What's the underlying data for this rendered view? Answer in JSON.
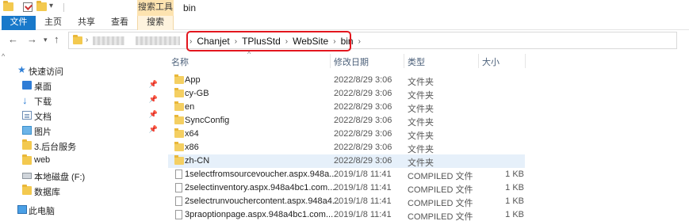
{
  "window": {
    "title": "bin",
    "context_tab_group": "搜索工具"
  },
  "ribbon": {
    "tabs": [
      "文件",
      "主页",
      "共享",
      "查看",
      "搜索"
    ]
  },
  "breadcrumb": [
    "Chanjet",
    "TPlusStd",
    "WebSite",
    "bin"
  ],
  "navpane": {
    "items": [
      {
        "label": "快速访问",
        "icon": "star-icon",
        "pinned": false
      },
      {
        "label": "桌面",
        "icon": "desktop-icon",
        "pinned": true
      },
      {
        "label": "下载",
        "icon": "download-icon",
        "pinned": true
      },
      {
        "label": "文档",
        "icon": "documents-icon",
        "pinned": true
      },
      {
        "label": "图片",
        "icon": "pictures-icon",
        "pinned": true
      },
      {
        "label": "3.后台服务",
        "icon": "folder-icon",
        "pinned": false
      },
      {
        "label": "web",
        "icon": "folder-icon",
        "pinned": false
      },
      {
        "label": "本地磁盘 (F:)",
        "icon": "drive-icon",
        "pinned": false
      },
      {
        "label": "数据库",
        "icon": "folder-icon",
        "pinned": false
      },
      {
        "label": "此电脑",
        "icon": "computer-icon",
        "pinned": false
      }
    ]
  },
  "columns": {
    "name": "名称",
    "date": "修改日期",
    "type": "类型",
    "size": "大小"
  },
  "files": [
    {
      "name": "App",
      "date": "2022/8/29 3:06",
      "type": "文件夹",
      "size": "",
      "kind": "folder"
    },
    {
      "name": "cy-GB",
      "date": "2022/8/29 3:06",
      "type": "文件夹",
      "size": "",
      "kind": "folder"
    },
    {
      "name": "en",
      "date": "2022/8/29 3:06",
      "type": "文件夹",
      "size": "",
      "kind": "folder"
    },
    {
      "name": "SyncConfig",
      "date": "2022/8/29 3:06",
      "type": "文件夹",
      "size": "",
      "kind": "folder"
    },
    {
      "name": "x64",
      "date": "2022/8/29 3:06",
      "type": "文件夹",
      "size": "",
      "kind": "folder"
    },
    {
      "name": "x86",
      "date": "2022/8/29 3:06",
      "type": "文件夹",
      "size": "",
      "kind": "folder"
    },
    {
      "name": "zh-CN",
      "date": "2022/8/29 3:06",
      "type": "文件夹",
      "size": "",
      "kind": "folder",
      "selected": true
    },
    {
      "name": "1selectfromsourcevoucher.aspx.948a...",
      "date": "2019/1/8 11:41",
      "type": "COMPILED 文件",
      "size": "1 KB",
      "kind": "file"
    },
    {
      "name": "2selectinventory.aspx.948a4bc1.com...",
      "date": "2019/1/8 11:41",
      "type": "COMPILED 文件",
      "size": "1 KB",
      "kind": "file"
    },
    {
      "name": "2selectrunvouchercontent.aspx.948a4...",
      "date": "2019/1/8 11:41",
      "type": "COMPILED 文件",
      "size": "1 KB",
      "kind": "file"
    },
    {
      "name": "3praoptionpage.aspx.948a4bc1.com...",
      "date": "2019/1/8 11:41",
      "type": "COMPILED 文件",
      "size": "1 KB",
      "kind": "file"
    }
  ]
}
